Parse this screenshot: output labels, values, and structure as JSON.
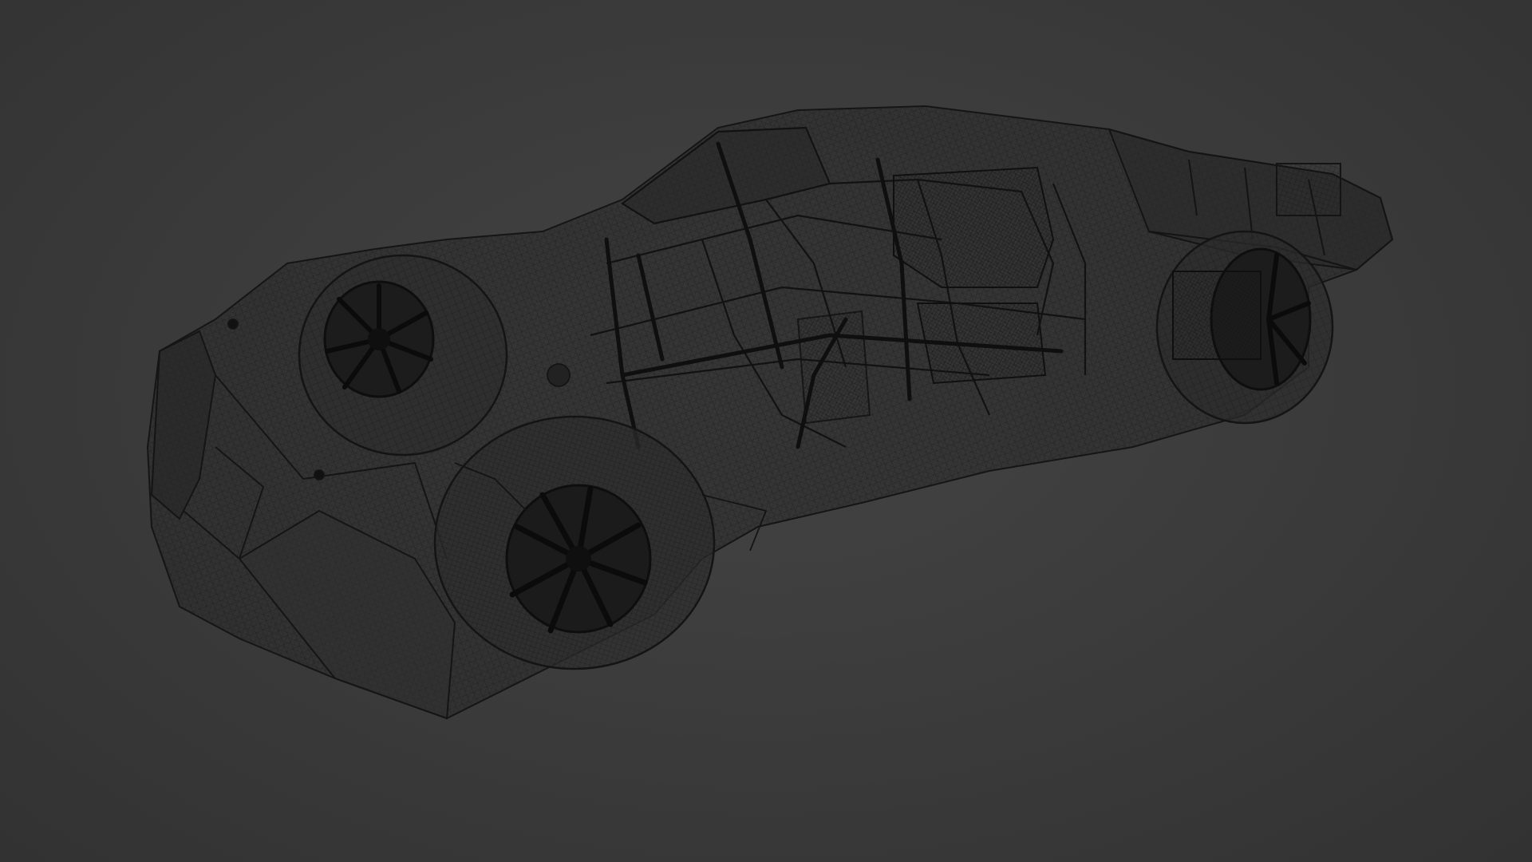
{
  "viewport": {
    "background_color": "#3c3c3c",
    "wire_color": "#141414",
    "mode": "wireframe"
  },
  "model": {
    "icon": "car-wireframe-model"
  }
}
